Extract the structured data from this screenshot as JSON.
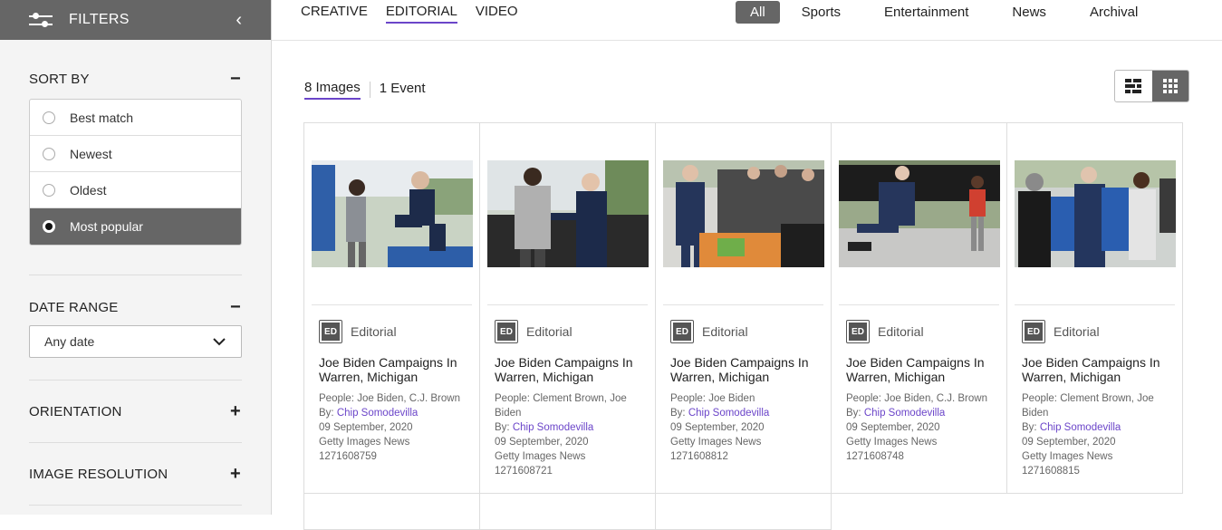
{
  "sidebar": {
    "title": "FILTERS",
    "sort": {
      "label": "SORT BY",
      "options": [
        "Best match",
        "Newest",
        "Oldest",
        "Most popular"
      ],
      "selected": "Most popular"
    },
    "date_range": {
      "label": "DATE RANGE",
      "value": "Any date"
    },
    "orientation": {
      "label": "ORIENTATION"
    },
    "resolution": {
      "label": "IMAGE RESOLUTION"
    }
  },
  "topnav": {
    "types": [
      "CREATIVE",
      "EDITORIAL",
      "VIDEO"
    ],
    "active_type": "EDITORIAL",
    "categories": [
      "All",
      "Sports",
      "Entertainment",
      "News",
      "Archival"
    ],
    "active_category": "All"
  },
  "results": {
    "tabs": [
      "8 Images",
      "1 Event"
    ],
    "active_tab": "8 Images"
  },
  "colors": {
    "accent": "#6b45c9",
    "dark": "#666666"
  },
  "cards": [
    {
      "badge": "ED",
      "type": "Editorial",
      "title": "Joe Biden Campaigns In Warren, Michigan",
      "people": "People: Joe Biden, C.J. Brown",
      "by": "By: ",
      "photographer": "Chip Somodevilla",
      "date": "09 September, 2020",
      "collection": "Getty Images News",
      "id": "1271608759"
    },
    {
      "badge": "ED",
      "type": "Editorial",
      "title": "Joe Biden Campaigns In Warren, Michigan",
      "people": "People: Clement Brown, Joe Biden",
      "by": "By: ",
      "photographer": "Chip Somodevilla",
      "date": "09 September, 2020",
      "collection": "Getty Images News",
      "id": "1271608721"
    },
    {
      "badge": "ED",
      "type": "Editorial",
      "title": "Joe Biden Campaigns In Warren, Michigan",
      "people": "People: Joe Biden",
      "by": "By: ",
      "photographer": "Chip Somodevilla",
      "date": "09 September, 2020",
      "collection": "Getty Images News",
      "id": "1271608812"
    },
    {
      "badge": "ED",
      "type": "Editorial",
      "title": "Joe Biden Campaigns In Warren, Michigan",
      "people": "People: Joe Biden, C.J. Brown",
      "by": "By: ",
      "photographer": "Chip Somodevilla",
      "date": "09 September, 2020",
      "collection": "Getty Images News",
      "id": "1271608748"
    },
    {
      "badge": "ED",
      "type": "Editorial",
      "title": "Joe Biden Campaigns In Warren, Michigan",
      "people": "People: Clement Brown, Joe Biden",
      "by": "By: ",
      "photographer": "Chip Somodevilla",
      "date": "09 September, 2020",
      "collection": "Getty Images News",
      "id": "1271608815"
    }
  ]
}
